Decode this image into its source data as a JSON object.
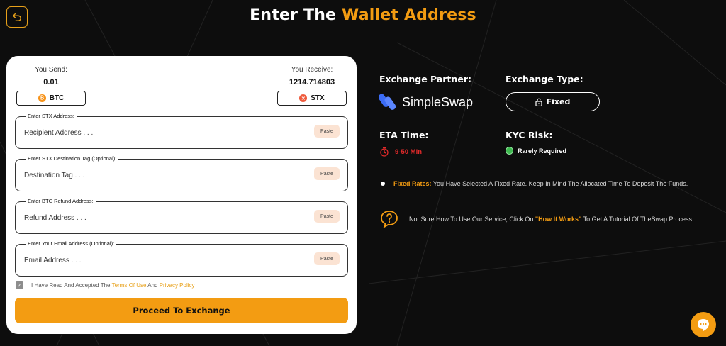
{
  "heading": {
    "part1": "Enter The",
    "highlight": "Wallet Address"
  },
  "send": {
    "label": "You Send:",
    "amount": "0.01",
    "coin": "BTC"
  },
  "receive": {
    "label": "You Receive:",
    "amount": "1214.714803",
    "coin": "STX"
  },
  "fields": [
    {
      "legend": "Enter STX Address:",
      "placeholder": "Recipient Address . . .",
      "paste": "Paste"
    },
    {
      "legend": "Enter STX Destination Tag (Optional):",
      "placeholder": "Destination Tag . . .",
      "paste": "Paste"
    },
    {
      "legend": "Enter BTC Refund Address:",
      "placeholder": "Refund Address . . .",
      "paste": "Paste"
    },
    {
      "legend": "Enter Your Email Address (Optional):",
      "placeholder": "Email Address . . .",
      "paste": "Paste"
    }
  ],
  "terms": {
    "prefix": "I Have Read And Accepted The",
    "terms_link": "Terms Of Use",
    "and": "And",
    "privacy_link": "Privacy Policy"
  },
  "proceed_label": "Proceed To Exchange",
  "info": {
    "partner_title": "Exchange Partner:",
    "partner_name": "SimpleSwap",
    "type_title": "Exchange Type:",
    "type_value": "Fixed",
    "eta_title": "ETA Time:",
    "eta_value": "9-50 Min",
    "kyc_title": "KYC Risk:",
    "kyc_value": "Rarely Required",
    "fixed_note_label": "Fixed Rates:",
    "fixed_note_text": "You Have Selected A Fixed Rate. Keep In Mind The Allocated Time To Deposit The Funds.",
    "help_prefix": "Not Sure How To Use Our Service, Click On",
    "help_link": "\"How It Works\"",
    "help_suffix": "To Get A Tutorial Of TheSwap Process."
  },
  "colors": {
    "accent": "#f39c12",
    "eta_red": "#e02a2a",
    "kyc_green": "#3fb950",
    "partner_blue": "#3b6cf6"
  },
  "icons": {
    "back": "undo-arrow-icon",
    "lock": "lock-icon",
    "timer": "timer-icon",
    "help": "help-bubble-icon",
    "chat": "chat-icon"
  }
}
